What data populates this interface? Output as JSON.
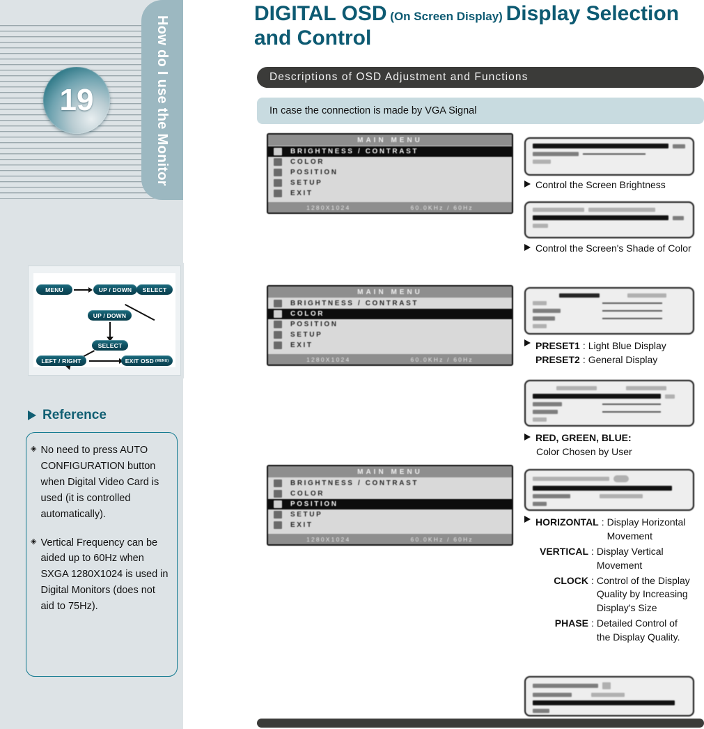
{
  "sidebar": {
    "chapter_number": "19",
    "tab_label": "How do I use the Monitor",
    "flow": {
      "nodes": [
        {
          "id": "menu",
          "label": "MENU"
        },
        {
          "id": "updown1",
          "label": "UP / DOWN"
        },
        {
          "id": "select1",
          "label": "SELECT"
        },
        {
          "id": "updown2",
          "label": "UP / DOWN"
        },
        {
          "id": "select2",
          "label": "SELECT"
        },
        {
          "id": "leftright",
          "label": "LEFT / RIGHT"
        },
        {
          "id": "exit",
          "label": "EXIT OSD",
          "sub": "(MENU)"
        }
      ]
    },
    "reference": {
      "heading": "Reference",
      "bullet_glyph": "◈",
      "items": [
        "No need to press AUTO CONFIGURATION button when Digital Video Card is used (it is controlled automatically).",
        "Vertical Frequency can be aided up to 60Hz  when SXGA 1280X1024 is used in Digital Monitors (does not aid to 75Hz)."
      ]
    }
  },
  "main": {
    "title_part1": "DIGITAL OSD",
    "title_part2": "(On Screen Display)",
    "title_part3": "Display Selection and Control",
    "section_band": "Descriptions of OSD Adjustment and Functions",
    "vga_note": "In case the connection is made by VGA Signal",
    "osd_screens": [
      {
        "title": "MAIN MENU",
        "items": [
          {
            "label": "BRIGHTNESS / CONTRAST",
            "selected": true
          },
          {
            "label": "COLOR",
            "selected": false
          },
          {
            "label": "POSITION",
            "selected": false
          },
          {
            "label": "SETUP",
            "selected": false
          },
          {
            "label": "EXIT",
            "selected": false
          }
        ],
        "footer_left": "1280X1024",
        "footer_right": "60.0KHz / 60Hz"
      },
      {
        "title": "MAIN MENU",
        "items": [
          {
            "label": "BRIGHTNESS / CONTRAST",
            "selected": false
          },
          {
            "label": "COLOR",
            "selected": true
          },
          {
            "label": "POSITION",
            "selected": false
          },
          {
            "label": "SETUP",
            "selected": false
          },
          {
            "label": "EXIT",
            "selected": false
          }
        ],
        "footer_left": "1280X1024",
        "footer_right": "60.0KHz / 60Hz"
      },
      {
        "title": "MAIN MENU",
        "items": [
          {
            "label": "BRIGHTNESS / CONTRAST",
            "selected": false
          },
          {
            "label": "COLOR",
            "selected": false
          },
          {
            "label": "POSITION",
            "selected": true
          },
          {
            "label": "SETUP",
            "selected": false
          },
          {
            "label": "EXIT",
            "selected": false
          }
        ],
        "footer_left": "1280X1024",
        "footer_right": "60.0KHz / 60Hz"
      }
    ],
    "captions": [
      {
        "id": "brightness",
        "marker": true,
        "text": "Control the Screen Brightness"
      },
      {
        "id": "color-shade",
        "marker": true,
        "text": "Control the Screen's Shade of Color"
      },
      {
        "id": "presets",
        "marker": true,
        "rows": [
          {
            "key": "PRESET1",
            "sep": ":",
            "value": "Light Blue Display"
          },
          {
            "key": "PRESET2",
            "sep": ":",
            "value": "General Display"
          }
        ]
      },
      {
        "id": "rgb",
        "marker": true,
        "bold_lead": "RED, GREEN, BLUE:",
        "text": "Color Chosen by User"
      },
      {
        "id": "position",
        "marker": true,
        "rows": [
          {
            "key": "HORIZONTAL",
            "sep": ":",
            "value": "Display Horizontal Movement"
          },
          {
            "key": "VERTICAL",
            "sep": ":",
            "value": "Display Vertical Movement"
          },
          {
            "key": "CLOCK",
            "sep": ":",
            "value": "Control of the Display Quality by Increasing Display's Size"
          },
          {
            "key": "PHASE",
            "sep": ":",
            "value": "Detailed Control of the Display Quality."
          }
        ]
      }
    ]
  },
  "colors": {
    "title": "#0d5a72",
    "band_dark": "#3b3b39",
    "band_light_blue": "#c8dbe0",
    "sidebar_bg": "#dde3e6",
    "tab_bg": "#9cb8c1",
    "accent_teal": "#115f73"
  }
}
